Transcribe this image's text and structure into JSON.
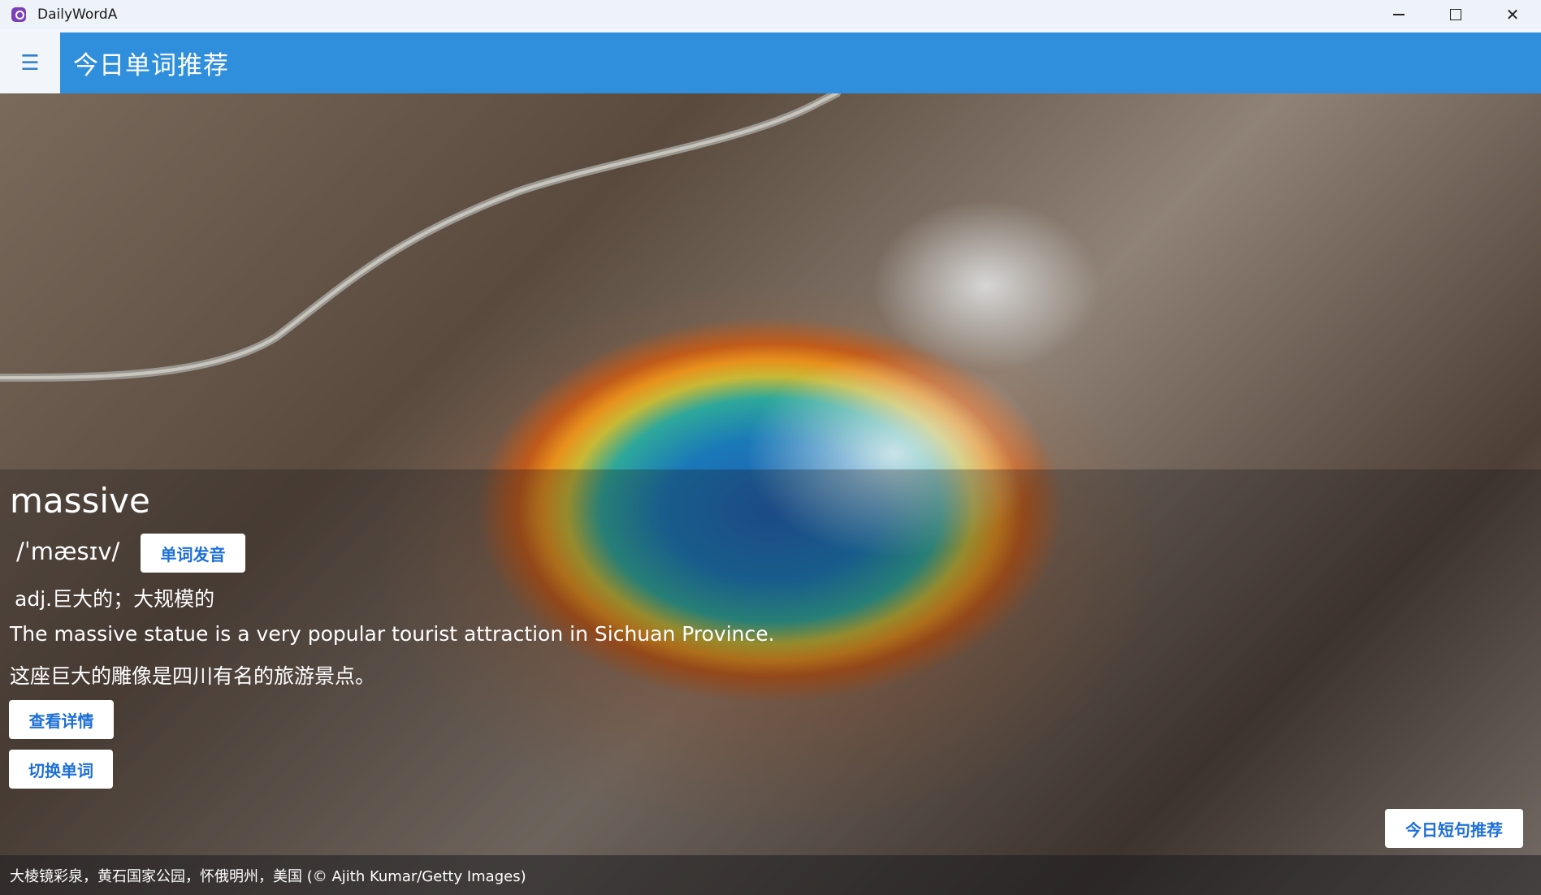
{
  "window": {
    "title": "DailyWordA",
    "controls": [
      "minimize",
      "maximize",
      "close"
    ]
  },
  "header": {
    "menu_icon": "hamburger-icon",
    "title": "今日单词推荐"
  },
  "word": {
    "text": "massive",
    "phonetic": "/ˈmæsɪv/",
    "pronounce_label": "单词发音",
    "definition": "adj.巨大的；大规模的",
    "example_en": "The massive statue is a very popular tourist attraction in Sichuan Province.",
    "example_zh": "这座巨大的雕像是四川有名的旅游景点。"
  },
  "actions": {
    "details_label": "查看详情",
    "switch_label": "切换单词",
    "sentence_label": "今日短句推荐"
  },
  "image_caption": "大棱镜彩泉，黄石国家公园，怀俄明州，美国 (© Ajith Kumar/Getty Images)"
}
